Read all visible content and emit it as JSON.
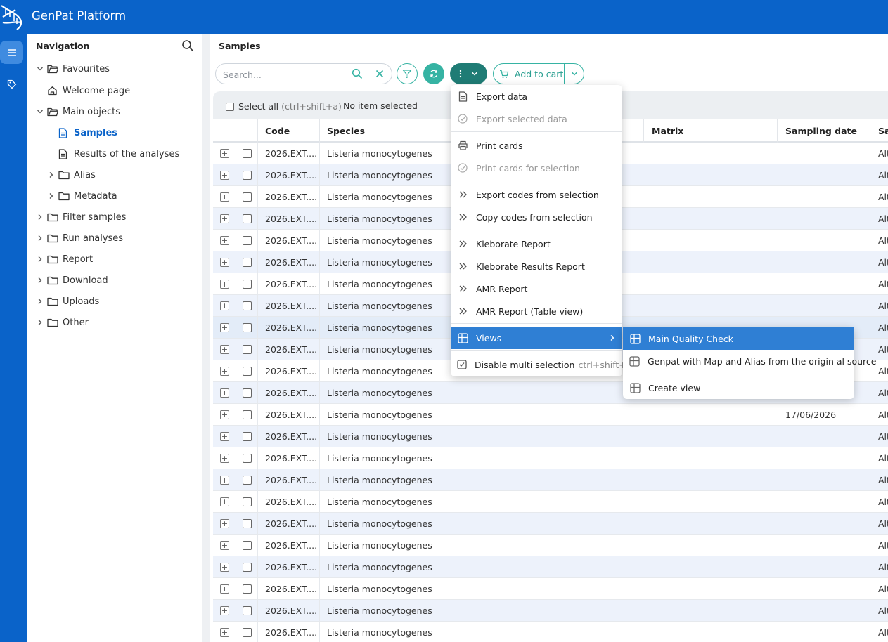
{
  "app": {
    "title": "GenPat Platform"
  },
  "rail": {
    "items": [
      "menu-icon",
      "tag-icon"
    ]
  },
  "navigation": {
    "title": "Navigation",
    "tree": [
      {
        "label": "Favourites",
        "icon": "folder-open-icon",
        "expanded": true
      },
      {
        "label": "Welcome page",
        "icon": "home-icon"
      },
      {
        "label": "Main objects",
        "icon": "folder-open-icon",
        "expanded": true
      },
      {
        "label": "Samples",
        "icon": "document-icon",
        "selected": true
      },
      {
        "label": "Results of the analyses",
        "icon": "document-icon"
      },
      {
        "label": "Alias",
        "icon": "folder-icon"
      },
      {
        "label": "Metadata",
        "icon": "folder-icon"
      },
      {
        "label": "Filter samples",
        "icon": "folder-icon"
      },
      {
        "label": "Run analyses",
        "icon": "folder-icon"
      },
      {
        "label": "Report",
        "icon": "folder-icon"
      },
      {
        "label": "Download",
        "icon": "folder-icon"
      },
      {
        "label": "Uploads",
        "icon": "folder-icon"
      },
      {
        "label": "Other",
        "icon": "folder-icon"
      }
    ]
  },
  "main": {
    "title": "Samples",
    "search": {
      "placeholder": "Search...",
      "value": ""
    },
    "toolbar": {
      "add_to_cart": "Add to cart"
    },
    "selection": {
      "select_all": "Select all",
      "shortcut": "(ctrl+shift+a)",
      "status": "No item selected"
    },
    "table": {
      "columns": [
        "Code",
        "Species",
        "Matrix",
        "Sampling date",
        "Sa"
      ],
      "rows": [
        {
          "code": "2026.EXT....",
          "species": "Listeria monocytogenes",
          "date": "",
          "last": "Alt"
        },
        {
          "code": "2026.EXT....",
          "species": "Listeria monocytogenes",
          "date": "",
          "last": "Alt"
        },
        {
          "code": "2026.EXT....",
          "species": "Listeria monocytogenes",
          "date": "",
          "last": "Alt"
        },
        {
          "code": "2026.EXT....",
          "species": "Listeria monocytogenes",
          "date": "",
          "last": "Alt"
        },
        {
          "code": "2026.EXT....",
          "species": "Listeria monocytogenes",
          "date": "",
          "last": "Alt"
        },
        {
          "code": "2026.EXT....",
          "species": "Listeria monocytogenes",
          "date": "",
          "last": "Alt"
        },
        {
          "code": "2026.EXT....",
          "species": "Listeria monocytogenes",
          "date": "",
          "last": "Alt"
        },
        {
          "code": "2026.EXT....",
          "species": "Listeria monocytogenes",
          "date": "",
          "last": "Alt"
        },
        {
          "code": "2026.EXT....",
          "species": "Listeria monocytogenes",
          "date": "",
          "last": "Alt"
        },
        {
          "code": "2026.EXT....",
          "species": "Listeria monocytogenes",
          "date": "",
          "last": "Alt"
        },
        {
          "code": "2026.EXT....",
          "species": "Listeria monocytogenes",
          "date": "",
          "last": "Alt"
        },
        {
          "code": "2026.EXT....",
          "species": "Listeria monocytogenes",
          "date": "",
          "last": "Alt"
        },
        {
          "code": "2026.EXT....",
          "species": "Listeria monocytogenes",
          "date": "17/06/2026",
          "last": "Alt"
        },
        {
          "code": "2026.EXT....",
          "species": "Listeria monocytogenes",
          "date": "",
          "last": "Alt"
        },
        {
          "code": "2026.EXT....",
          "species": "Listeria monocytogenes",
          "date": "",
          "last": "Alt"
        },
        {
          "code": "2026.EXT....",
          "species": "Listeria monocytogenes",
          "date": "",
          "last": "Alt"
        },
        {
          "code": "2026.EXT....",
          "species": "Listeria monocytogenes",
          "date": "",
          "last": "Alt"
        },
        {
          "code": "2026.EXT....",
          "species": "Listeria monocytogenes",
          "date": "",
          "last": "Alt"
        },
        {
          "code": "2026.EXT....",
          "species": "Listeria monocytogenes",
          "date": "",
          "last": "Alt"
        },
        {
          "code": "2026.EXT....",
          "species": "Listeria monocytogenes",
          "date": "",
          "last": "Alt"
        },
        {
          "code": "2026.EXT....",
          "species": "Listeria monocytogenes",
          "date": "",
          "last": "Alt"
        },
        {
          "code": "2026.EXT....",
          "species": "Listeria monocytogenes",
          "date": "",
          "last": "Alt"
        },
        {
          "code": "2026.EXT....",
          "species": "Listeria monocytogenes",
          "date": "",
          "last": "Alt"
        }
      ]
    }
  },
  "actions_menu": {
    "items": [
      {
        "label": "Export data",
        "icon": "document-icon"
      },
      {
        "label": "Export selected data",
        "icon": "check-circle-icon",
        "disabled": true
      },
      {
        "label": "Print cards",
        "icon": "printer-icon"
      },
      {
        "label": "Print cards for selection",
        "icon": "check-circle-icon",
        "disabled": true
      },
      {
        "label": "Export codes from selection",
        "icon": "double-chevron-icon"
      },
      {
        "label": "Copy codes from selection",
        "icon": "double-chevron-icon"
      },
      {
        "label": "Kleborate Report",
        "icon": "double-chevron-icon"
      },
      {
        "label": "Kleborate Results Report",
        "icon": "double-chevron-icon"
      },
      {
        "label": "AMR Report",
        "icon": "double-chevron-icon"
      },
      {
        "label": "AMR Report (Table view)",
        "icon": "double-chevron-icon"
      },
      {
        "label": "Views",
        "icon": "table-icon",
        "active": true
      },
      {
        "label": "Disable multi selection",
        "icon": "checkbox-icon",
        "shortcut": "ctrl+shift+m"
      }
    ]
  },
  "views_submenu": {
    "items": [
      {
        "label": "Main Quality Check",
        "icon": "table-icon",
        "active": true
      },
      {
        "label": "Genpat with Map and Alias from the origin al source",
        "icon": "table-icon"
      },
      {
        "label": "Create view",
        "icon": "table-icon"
      }
    ]
  },
  "colors": {
    "brand": "#0a63c9",
    "teal": "#36b3a3",
    "dark_teal": "#1f7c75",
    "menu_active": "#2f7fd4",
    "row_alt": "#edf2fb"
  }
}
